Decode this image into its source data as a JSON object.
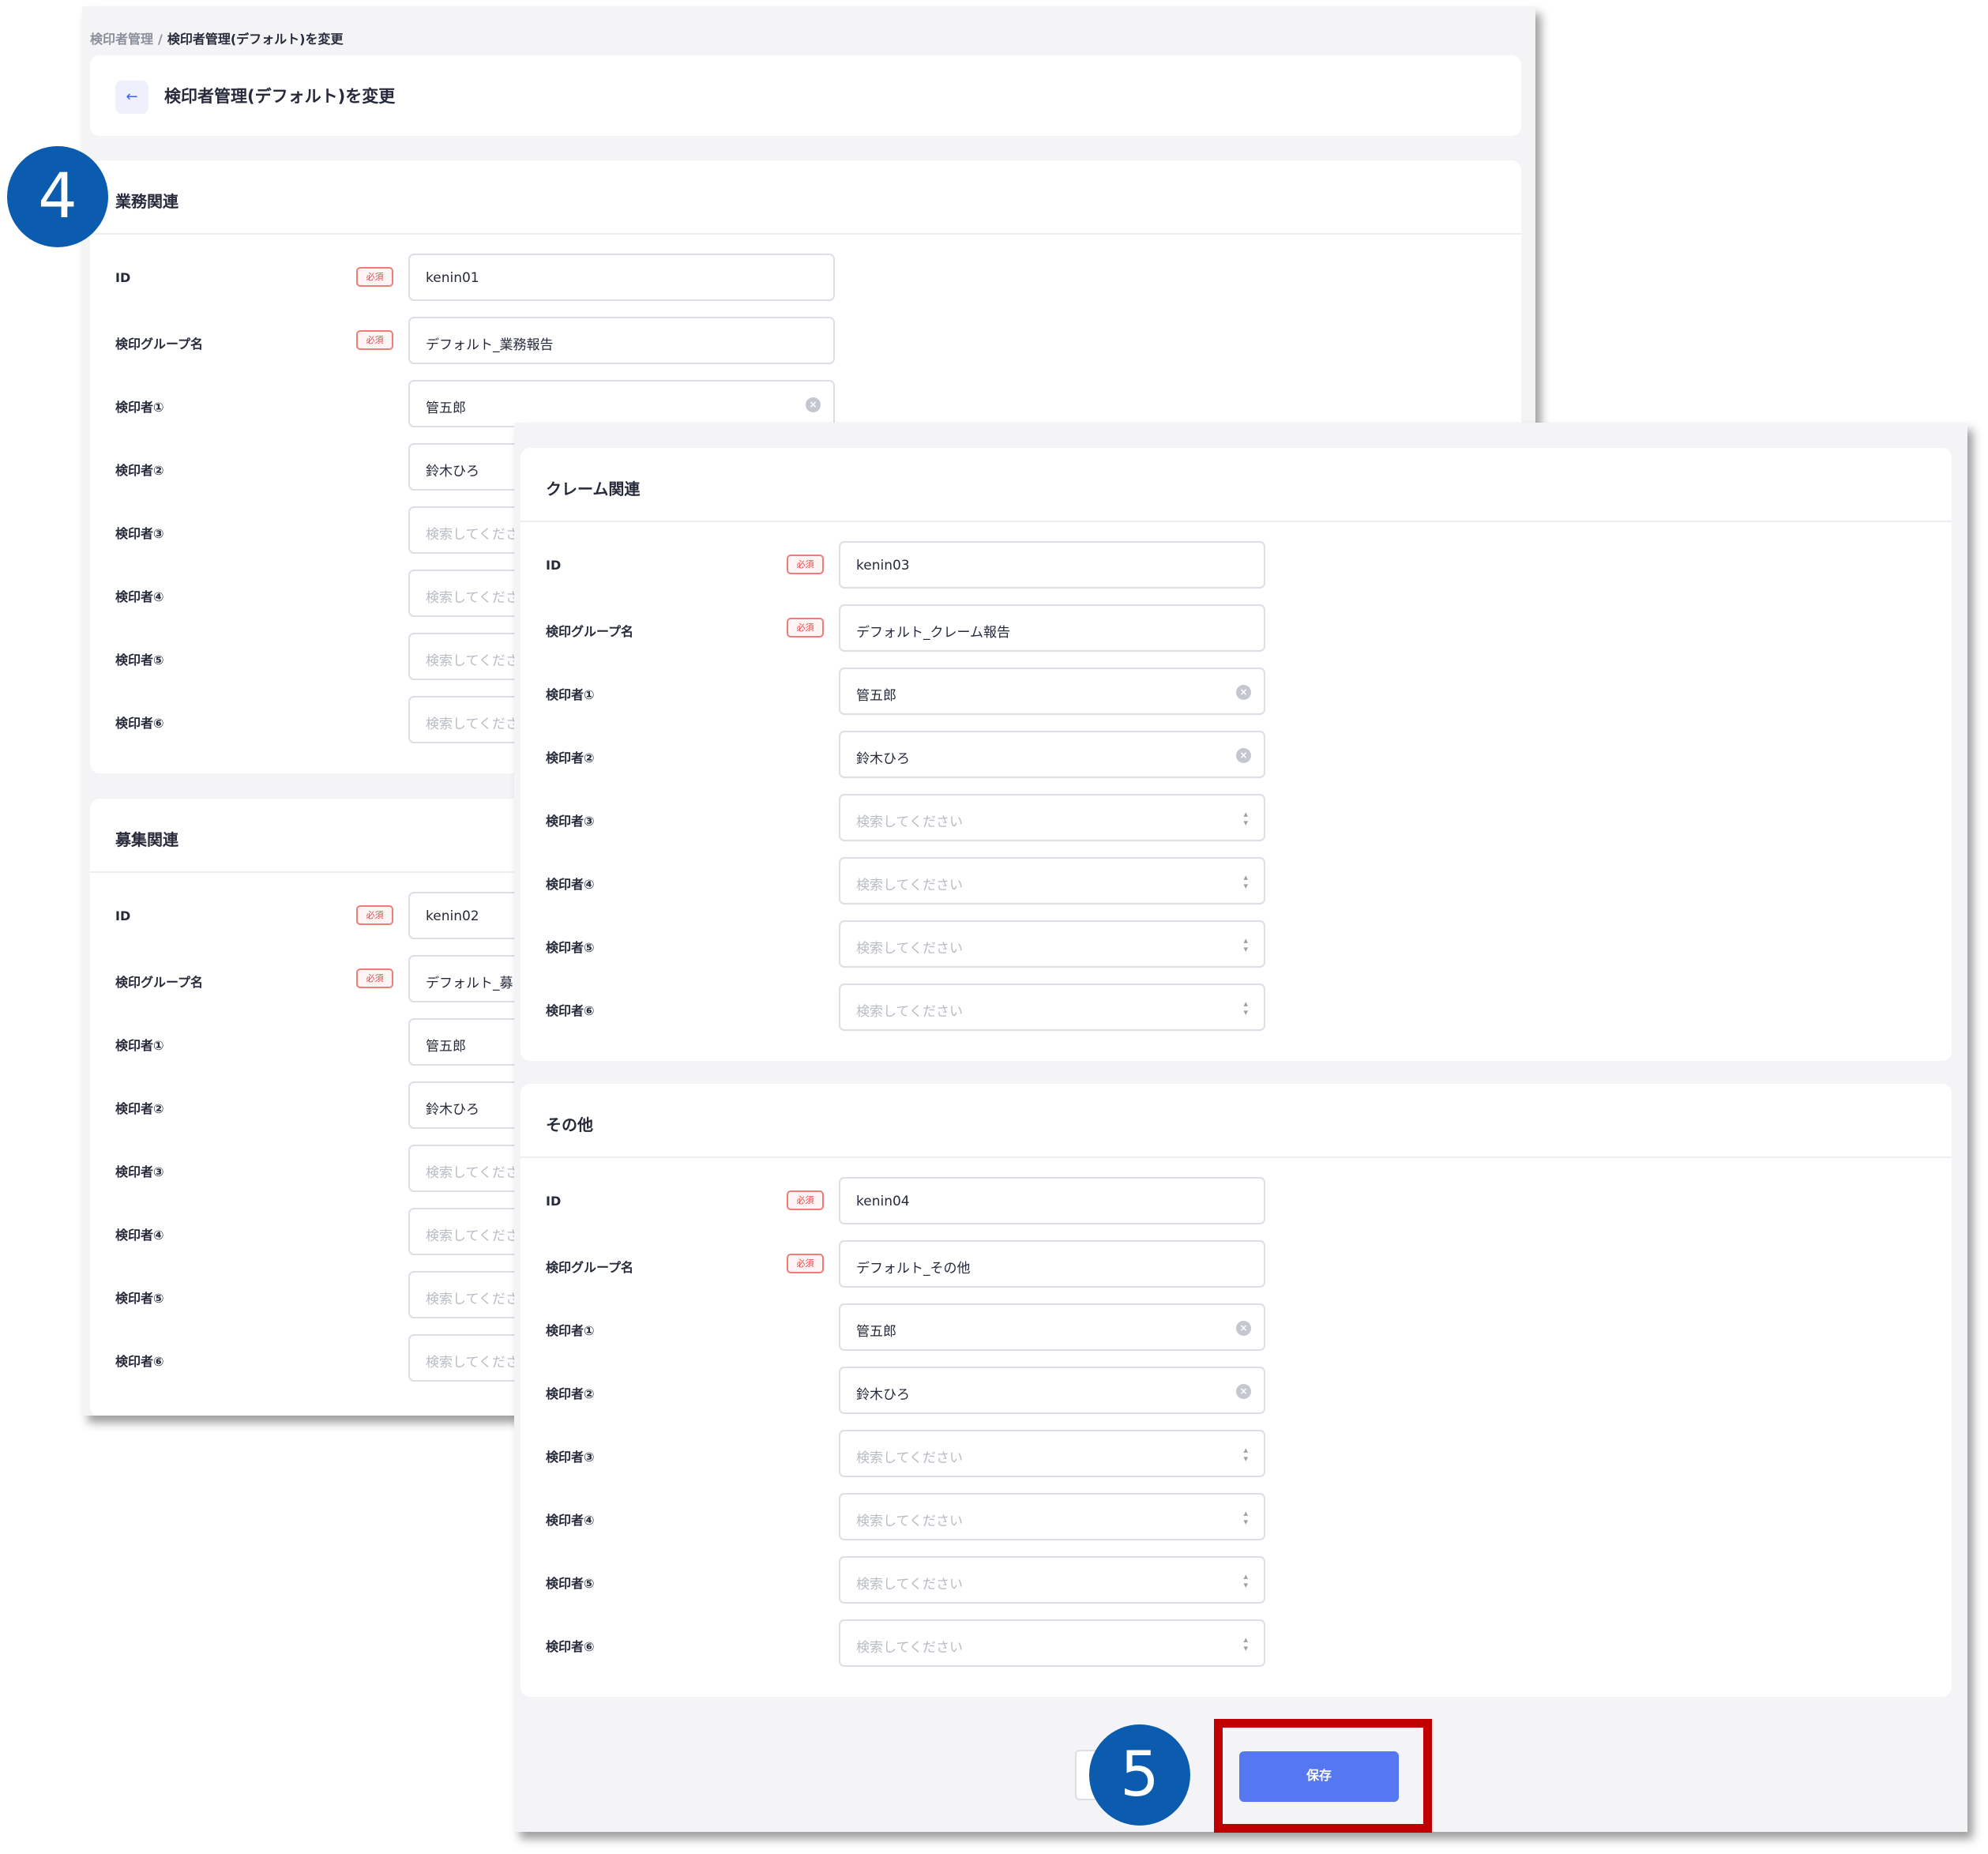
{
  "breadcrumb": {
    "parent": "検印者管理",
    "separator": "/",
    "current": "検印者管理(デフォルト)を変更"
  },
  "page_title": "検印者管理(デフォルト)を変更",
  "icons": {
    "back": "arrow-left-icon",
    "clear": "clear-circle-icon",
    "select": "chevron-up-down-icon"
  },
  "colors": {
    "primary": "#5577f1",
    "required": "#e54848",
    "highlight": "#c00000",
    "step_badge": "#0b5cae"
  },
  "labels": {
    "id": "ID",
    "group_name": "検印グループ名",
    "required": "必須",
    "stamper_1": "検印者①",
    "stamper_2": "検印者②",
    "stamper_3": "検印者③",
    "stamper_4": "検印者④",
    "stamper_5": "検印者⑤",
    "stamper_6": "検印者⑥"
  },
  "placeholder": "検索してください",
  "placeholder_clipped": "検索してくださ",
  "sections": {
    "gyomu": {
      "title": "業務関連",
      "id": "kenin01",
      "group_name": "デフォルト_業務報告",
      "stamper_1": "管五郎",
      "stamper_2": "鈴木ひろ"
    },
    "boshu": {
      "title": "募集関連",
      "id": "kenin02",
      "group_name_clipped": "デフォルト_募",
      "stamper_1": "管五郎",
      "stamper_2": "鈴木ひろ"
    },
    "claim": {
      "title": "クレーム関連",
      "id": "kenin03",
      "group_name": "デフォルト_クレーム報告",
      "stamper_1": "管五郎",
      "stamper_2": "鈴木ひろ"
    },
    "sonota": {
      "title": "その他",
      "id": "kenin04",
      "group_name": "デフォルト_その他",
      "stamper_1": "管五郎",
      "stamper_2": "鈴木ひろ"
    }
  },
  "actions": {
    "save_label": "保存"
  },
  "step_badges": {
    "step_4": "4",
    "step_5": "5"
  }
}
